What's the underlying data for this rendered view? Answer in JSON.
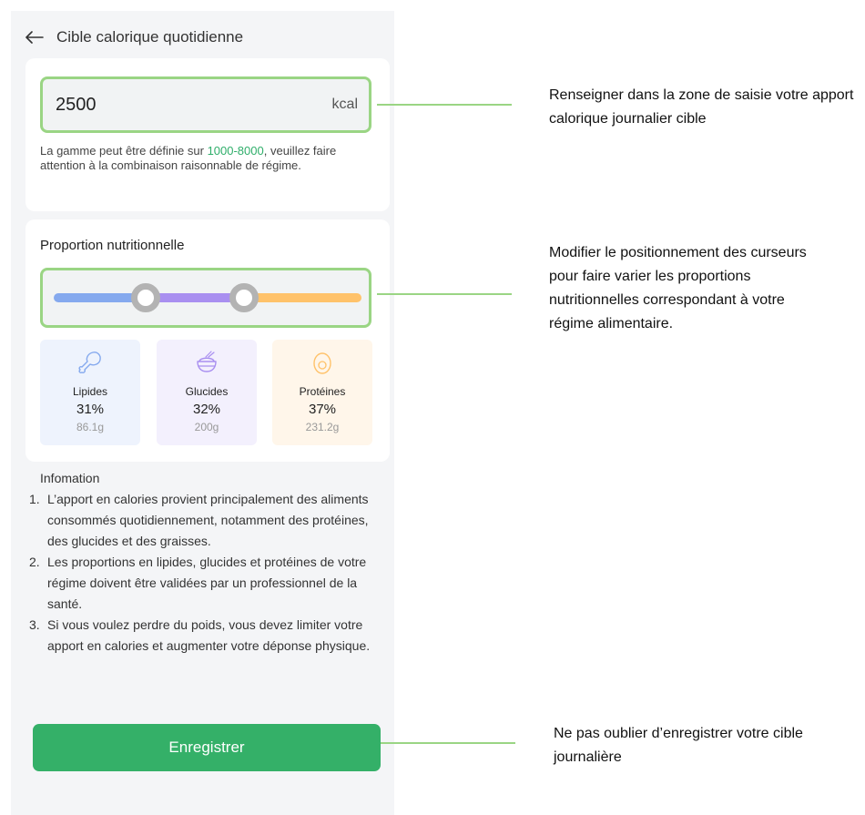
{
  "header": {
    "title": "Cible calorique quotidienne"
  },
  "kcal": {
    "value": "2500",
    "unit": "kcal",
    "hint_before": "La gamme peut être définie sur ",
    "hint_range": "1000-8000",
    "hint_after": ", veuillez faire attention à la combinaison raisonnable de régime."
  },
  "nutrition": {
    "title": "Proportion nutritionnelle",
    "slider": {
      "fat_pct": 31,
      "carb_pct": 32,
      "protein_pct": 37
    },
    "macros": [
      {
        "name": "Lipides",
        "percent": "31%",
        "grams": "86.1g",
        "icon": "drumstick-icon",
        "color": "#85a9ee"
      },
      {
        "name": "Glucides",
        "percent": "32%",
        "grams": "200g",
        "icon": "rice-bowl-icon",
        "color": "#a98ff0"
      },
      {
        "name": "Protéines",
        "percent": "37%",
        "grams": "231.2g",
        "icon": "egg-icon",
        "color": "#ffc26a"
      }
    ]
  },
  "info": {
    "title": "Infomation",
    "items": [
      {
        "num": "1.",
        "text": "L’apport en calories provient principalement des aliments consommés quotidiennement, notamment des protéines, des glucides et des graisses."
      },
      {
        "num": "2.",
        "text": "Les proportions en lipides, glucides et protéines de votre régime doivent être validées par un professionnel de la santé."
      },
      {
        "num": "3.",
        "text": "Si vous voulez perdre du poids, vous devez limiter votre apport en calories et augmenter votre déponse physique."
      }
    ]
  },
  "save_label": "Enregistrer",
  "annotations": [
    "Renseigner dans la zone de saisie votre apport calorique journalier cible",
    "Modifier le positionnement des curseurs pour faire varier les proportions nutritionnelles correspondant à votre régime alimentaire.",
    "Ne pas oublier d’enregistrer votre cible journalière"
  ],
  "colors": {
    "accent_green": "#34b068",
    "highlight_green": "#9ad584",
    "range_green": "#2fae6a"
  }
}
